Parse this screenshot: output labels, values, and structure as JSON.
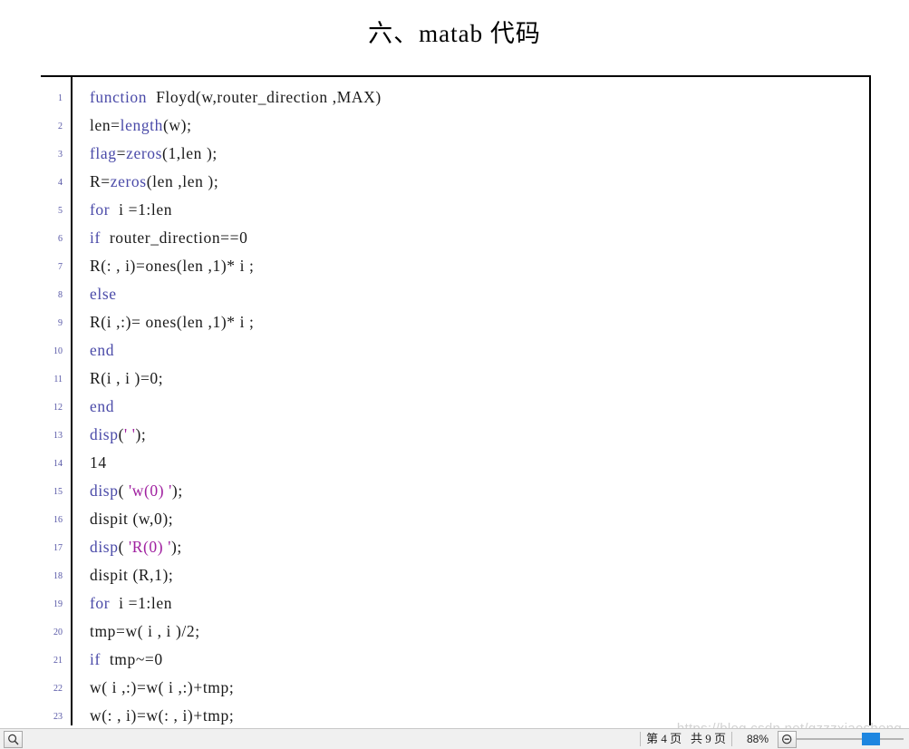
{
  "document": {
    "title": "六、matab 代码",
    "watermark": "https://blog.csdn.net/qzzzxiaosheng"
  },
  "colors": {
    "keyword": "#4a4aa8",
    "string": "#a020a0",
    "plain": "#1a1a1a",
    "line_number": "#5555a5",
    "border": "#000000",
    "status_bar_bg": "#f0f0f0",
    "slider_thumb": "#1e86e0",
    "watermark": "#d2d2d2"
  },
  "code": {
    "language": "matlab",
    "lines": [
      {
        "n": "1",
        "tokens": [
          {
            "t": "kw",
            "s": "function"
          },
          {
            "t": "pln",
            "s": "  Floyd(w,router_direction ,MAX)"
          }
        ]
      },
      {
        "n": "2",
        "tokens": [
          {
            "t": "pln",
            "s": "len="
          },
          {
            "t": "kw",
            "s": "length"
          },
          {
            "t": "pln",
            "s": "(w);"
          }
        ]
      },
      {
        "n": "3",
        "tokens": [
          {
            "t": "kw",
            "s": "flag"
          },
          {
            "t": "pln",
            "s": "="
          },
          {
            "t": "kw",
            "s": "zeros"
          },
          {
            "t": "pln",
            "s": "(1,len );"
          }
        ]
      },
      {
        "n": "4",
        "tokens": [
          {
            "t": "pln",
            "s": "R="
          },
          {
            "t": "kw",
            "s": "zeros"
          },
          {
            "t": "pln",
            "s": "(len ,len );"
          }
        ]
      },
      {
        "n": "5",
        "tokens": [
          {
            "t": "kw",
            "s": "for"
          },
          {
            "t": "pln",
            "s": "  i =1:len"
          }
        ]
      },
      {
        "n": "6",
        "tokens": [
          {
            "t": "kw",
            "s": "if"
          },
          {
            "t": "pln",
            "s": "  router_direction==0"
          }
        ]
      },
      {
        "n": "7",
        "tokens": [
          {
            "t": "pln",
            "s": "R(: , i)=ones(len ,1)* i ;"
          }
        ]
      },
      {
        "n": "8",
        "tokens": [
          {
            "t": "kw",
            "s": "else"
          }
        ]
      },
      {
        "n": "9",
        "tokens": [
          {
            "t": "pln",
            "s": "R(i ,:)= ones(len ,1)* i ;"
          }
        ]
      },
      {
        "n": "10",
        "tokens": [
          {
            "t": "kw",
            "s": "end"
          }
        ]
      },
      {
        "n": "11",
        "tokens": [
          {
            "t": "pln",
            "s": "R(i , i )=0;"
          }
        ]
      },
      {
        "n": "12",
        "tokens": [
          {
            "t": "kw",
            "s": "end"
          }
        ]
      },
      {
        "n": "13",
        "tokens": [
          {
            "t": "kw",
            "s": "disp"
          },
          {
            "t": "pln",
            "s": "("
          },
          {
            "t": "str",
            "s": "' '"
          },
          {
            "t": "pln",
            "s": ");"
          }
        ]
      },
      {
        "n": "14",
        "tokens": [
          {
            "t": "pln",
            "s": "14"
          }
        ]
      },
      {
        "n": "15",
        "tokens": [
          {
            "t": "kw",
            "s": "disp"
          },
          {
            "t": "pln",
            "s": "( "
          },
          {
            "t": "str",
            "s": "'w(0) '"
          },
          {
            "t": "pln",
            "s": ");"
          }
        ]
      },
      {
        "n": "16",
        "tokens": [
          {
            "t": "pln",
            "s": "dispit (w,0);"
          }
        ]
      },
      {
        "n": "17",
        "tokens": [
          {
            "t": "kw",
            "s": "disp"
          },
          {
            "t": "pln",
            "s": "( "
          },
          {
            "t": "str",
            "s": "'R(0) '"
          },
          {
            "t": "pln",
            "s": ");"
          }
        ]
      },
      {
        "n": "18",
        "tokens": [
          {
            "t": "pln",
            "s": "dispit (R,1);"
          }
        ]
      },
      {
        "n": "19",
        "tokens": [
          {
            "t": "kw",
            "s": "for"
          },
          {
            "t": "pln",
            "s": "  i =1:len"
          }
        ]
      },
      {
        "n": "20",
        "tokens": [
          {
            "t": "pln",
            "s": "tmp=w( i , i )/2;"
          }
        ]
      },
      {
        "n": "21",
        "tokens": [
          {
            "t": "kw",
            "s": "if"
          },
          {
            "t": "pln",
            "s": "  tmp~=0"
          }
        ]
      },
      {
        "n": "22",
        "tokens": [
          {
            "t": "pln",
            "s": "w( i ,:)=w( i ,:)+tmp;"
          }
        ]
      },
      {
        "n": "23",
        "tokens": [
          {
            "t": "pln",
            "s": "w(: , i)=w(: , i)+tmp;"
          }
        ]
      }
    ]
  },
  "status_bar": {
    "find_icon": "magnifier-icon",
    "page_current_prefix": "第",
    "page_current": "4",
    "page_current_suffix": "页",
    "page_total_prefix": "共",
    "page_total": "9",
    "page_total_suffix": "页",
    "page_label": "第 4 页  共 9 页",
    "zoom_level": "88%",
    "zoom_icon": "magnifier-minus-icon",
    "slider_value": "88"
  }
}
